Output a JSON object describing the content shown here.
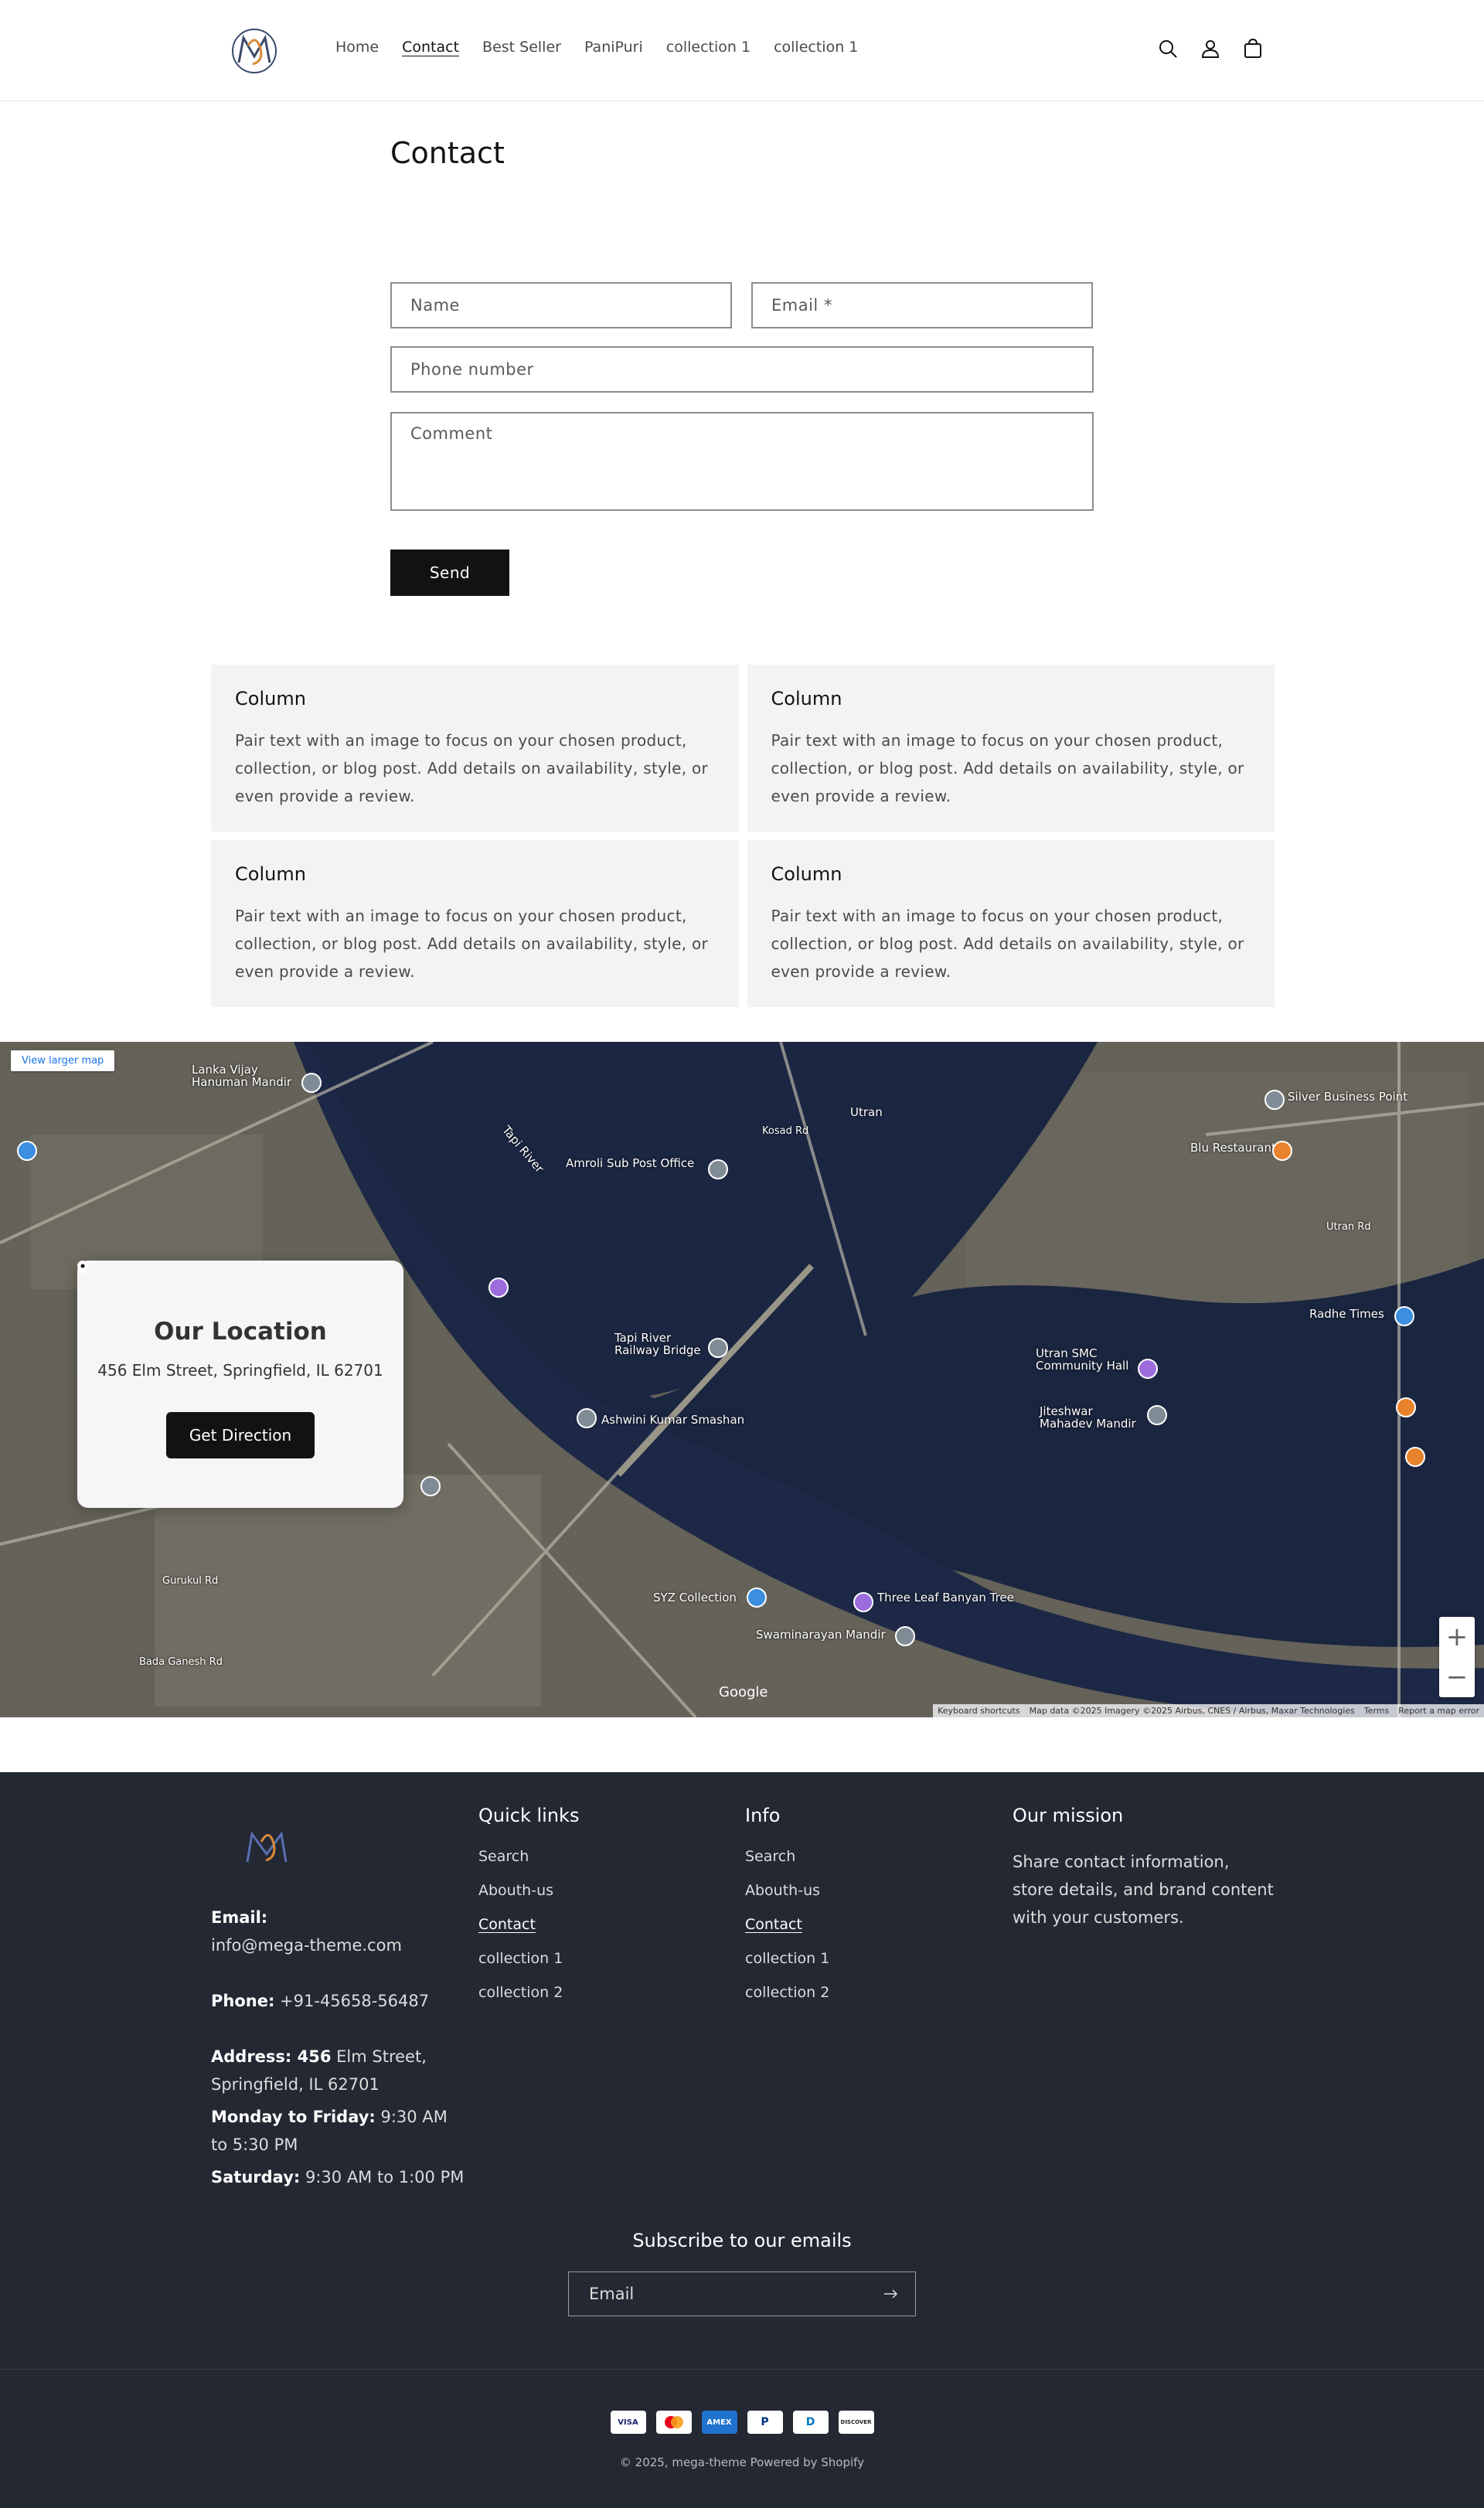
{
  "header": {
    "nav": [
      "Home",
      "Contact",
      "Best Seller",
      "PaniPuri",
      "collection 1",
      "collection 1"
    ],
    "active_nav": "Contact"
  },
  "contact": {
    "title": "Contact",
    "name_placeholder": "Name",
    "email_placeholder": "Email *",
    "phone_placeholder": "Phone number",
    "comment_placeholder": "Comment",
    "send_label": "Send"
  },
  "columns": [
    {
      "heading": "Column",
      "text": "Pair text with an image to focus on your chosen product, collection, or blog post. Add details on availability, style, or even provide a review."
    },
    {
      "heading": "Column",
      "text": "Pair text with an image to focus on your chosen product, collection, or blog post. Add details on availability, style, or even provide a review."
    },
    {
      "heading": "Column",
      "text": "Pair text with an image to focus on your chosen product, collection, or blog post. Add details on availability, style, or even provide a review."
    },
    {
      "heading": "Column",
      "text": "Pair text with an image to focus on your chosen product, collection, or blog post. Add details on availability, style, or even provide a review."
    }
  ],
  "map": {
    "view_larger": "View larger map",
    "location_title": "Our Location",
    "location_address": "456 Elm Street, Springfield, IL 62701",
    "direction_label": "Get Direction",
    "attribution": [
      "Keyboard shortcuts",
      "Map data ©2025 Imagery ©2025 Airbus, CNES / Airbus, Maxar Technologies",
      "Terms",
      "Report a map error"
    ],
    "google": "Google",
    "labels": {
      "l1": "Tapi River",
      "l2": "Amroli Sub Post Office",
      "l3": "Tapi River Railway Bridge",
      "l4": "Ashwini Kumar Smashan",
      "l5": "Three Leaf Banyan Tree",
      "l6": "SYZ Collection",
      "l7": "Swaminarayan Mandir",
      "l8": "Utran SMC Community Hall",
      "l9": "Jiteshwar Mahadev Mandir",
      "l10": "Silver Business Point",
      "l11": "Radhe Times",
      "l12": "Blu Restaurant",
      "l13": "Lanka Vijay Hanuman Mandir",
      "l14": "Utran",
      "l15": "Kosad Rd",
      "l16": "Utran Rd",
      "l17": "Gurukul Rd",
      "l18": "Bada Ganesh Rd"
    }
  },
  "footer": {
    "email_label": "Email:",
    "email_value": "info@mega-theme.com",
    "phone_label": "Phone:",
    "phone_value": "+91-45658-56487",
    "address_label": "Address: 456",
    "address_value": "Elm Street, Springfield, IL 62701",
    "weekday_label": "Monday to Friday:",
    "weekday_value": "9:30 AM to 5:30 PM",
    "saturday_label": "Saturday:",
    "saturday_value": "9:30 AM to 1:00 PM",
    "quick_links_title": "Quick links",
    "quick_links": [
      "Search",
      "Abouth-us",
      "Contact",
      "collection 1",
      "collection 2"
    ],
    "info_title": "Info",
    "info_links": [
      "Search",
      "Abouth-us",
      "Contact",
      "collection 1",
      "collection 2"
    ],
    "mission_title": "Our mission",
    "mission_text": "Share contact information, store details, and brand content with your customers.",
    "subscribe_title": "Subscribe to our emails",
    "subscribe_placeholder": "Email",
    "payments": [
      "VISA",
      "MC",
      "AMEX",
      "P",
      "D",
      "DISCOVER"
    ],
    "copyright": "© 2025, mega-theme Powered by Shopify"
  },
  "colors": {
    "accent": "#121212",
    "footer_bg": "#242833",
    "column_bg": "#f3f3f3"
  }
}
